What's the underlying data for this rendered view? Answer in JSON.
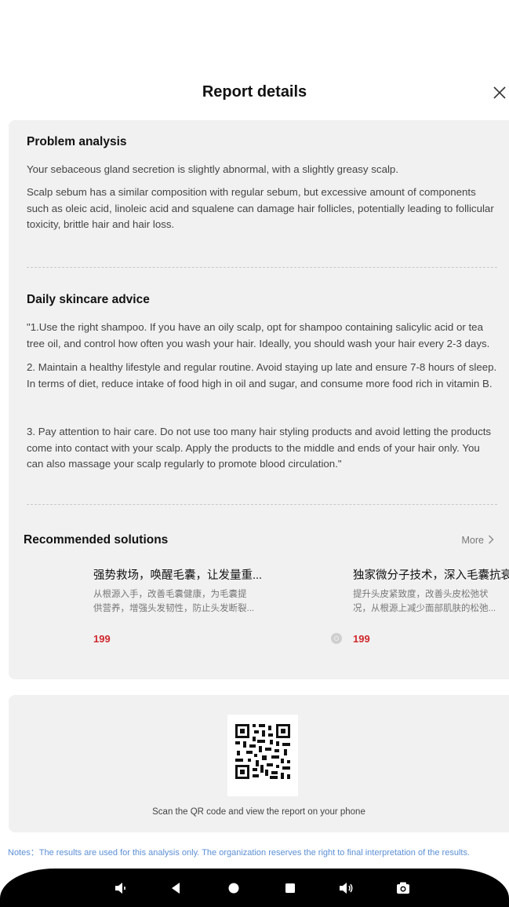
{
  "header": {
    "title": "Report details"
  },
  "problem": {
    "heading": "Problem analysis",
    "p1": "Your sebaceous gland secretion is slightly abnormal, with a slightly greasy scalp.",
    "p2": "Scalp sebum has a similar composition with regular sebum, but excessive amount of components such as oleic acid, linoleic acid and squalene can damage hair follicles, potentially leading to follicular toxicity, brittle hair and hair loss."
  },
  "advice": {
    "heading": "Daily skincare advice",
    "p1": "\"1.Use the right shampoo. If you have an oily scalp, opt for shampoo containing salicylic acid or tea tree oil, and control how often you wash your hair. Ideally, you should wash your hair every 2-3 days.",
    "p2": "2. Maintain a healthy lifestyle and regular routine. Avoid staying up late and ensure 7-8 hours of sleep. In terms of diet, reduce intake of food high in oil and sugar, and consume more food rich in vitamin B.",
    "p3": "3. Pay attention to hair care.  Do not use too many hair styling products and avoid letting the products come into contact with your scalp. Apply the products to the middle and ends of your hair only. You can also massage your scalp regularly to promote blood circulation.\""
  },
  "recommended": {
    "heading": "Recommended solutions",
    "more_label": "More",
    "products": [
      {
        "title": "强势救场，唤醒毛囊，让发量重...",
        "desc_line1": "从根源入手，改善毛囊健康，为毛囊提",
        "desc_line2": "供营养，增强头发韧性，防止头发断裂...",
        "price": "199"
      },
      {
        "title": "独家微分子技术，深入毛囊抗衰",
        "desc_line1": "提升头皮紧致度，改善头皮松弛状",
        "desc_line2": "况，从根源上减少面部肌肤的松弛...",
        "price": "199"
      }
    ]
  },
  "qr": {
    "caption": "Scan the QR code and view the report on your phone"
  },
  "notes": "Notes：The results are used for this analysis only. The organization reserves the right to final interpretation of the results.",
  "colors": {
    "accent_price": "#d1282c",
    "notes": "#5b8fd6",
    "card_bg": "#f1f1f1"
  }
}
